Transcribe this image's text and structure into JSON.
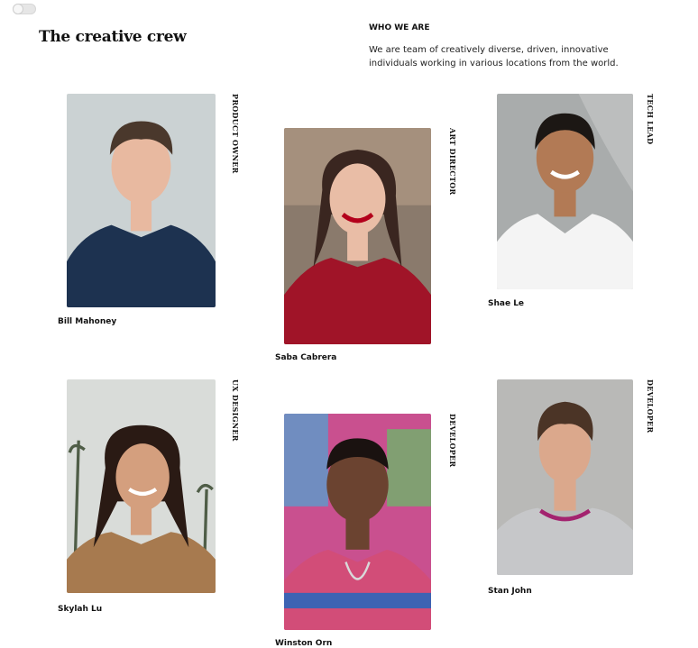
{
  "header": {
    "title": "The creative crew",
    "about_heading": "WHO WE ARE",
    "about_text": "We are team of creatively diverse, driven, innovative individuals working in various locations from the world."
  },
  "team": [
    {
      "name": "Bill Mahoney",
      "role": "PRODUCT OWNER",
      "colors": {
        "bg": "#cbd2d3",
        "skin": "#e8b9a0",
        "hair": "#4a382c",
        "shirt": "#1d3250"
      }
    },
    {
      "name": "Saba Cabrera",
      "role": "ART DIRECTOR",
      "colors": {
        "bg": "#8a7a6c",
        "skin": "#e9bda6",
        "hair": "#3a2620",
        "shirt": "#a01428"
      }
    },
    {
      "name": "Shae Le",
      "role": "TECH LEAD",
      "colors": {
        "bg": "#a9acac",
        "skin": "#b27a55",
        "hair": "#1c1714",
        "shirt": "#f4f4f4"
      }
    },
    {
      "name": "Skylah Lu",
      "role": "UX DESIGNER",
      "colors": {
        "bg": "#d9dcd9",
        "skin": "#d49f7e",
        "hair": "#2a1a14",
        "shirt": "#a77a4f"
      }
    },
    {
      "name": "Winston Orn",
      "role": "DEVELOPER",
      "colors": {
        "bg": "#c9508f",
        "skin": "#6b4330",
        "hair": "#1a1210",
        "shirt": "#d24d78"
      }
    },
    {
      "name": "Stan John",
      "role": "DEVELOPER",
      "colors": {
        "bg": "#b9b9b7",
        "skin": "#dba88c",
        "hair": "#4b3426",
        "shirt": "#c6c7c9"
      }
    }
  ]
}
